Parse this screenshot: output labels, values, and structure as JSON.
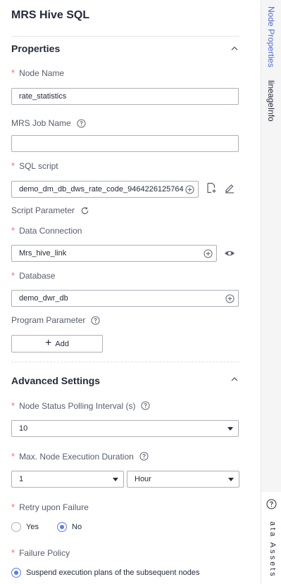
{
  "panel": {
    "title": "MRS Hive SQL"
  },
  "properties": {
    "section_title": "Properties",
    "node_name": {
      "label": "Node Name",
      "value": "rate_statistics"
    },
    "mrs_job_name": {
      "label": "MRS Job Name",
      "value": ""
    },
    "sql_script": {
      "label": "SQL script",
      "value": "demo_dm_db_dws_rate_code_9464226125764"
    },
    "script_parameter": {
      "label": "Script Parameter"
    },
    "data_connection": {
      "label": "Data Connection",
      "value": "Mrs_hive_link"
    },
    "database": {
      "label": "Database",
      "value": "demo_dwr_db"
    },
    "program_parameter": {
      "label": "Program Parameter",
      "add_label": "Add"
    }
  },
  "advanced": {
    "section_title": "Advanced Settings",
    "polling_interval": {
      "label": "Node Status Polling Interval (s)",
      "value": "10"
    },
    "max_duration": {
      "label": "Max. Node Execution Duration",
      "value": "1",
      "unit": "Hour"
    },
    "retry": {
      "label": "Retry upon Failure",
      "options": [
        "Yes",
        "No"
      ],
      "selected": "No"
    },
    "failure_policy": {
      "label": "Failure Policy",
      "selected_option": "Suspend execution plans of the subsequent nodes"
    }
  },
  "rail": {
    "tab_node_properties": "Node Properties",
    "tab_lineage": "lineageInfo",
    "assistant_text": "ata Assets"
  },
  "colors": {
    "accent": "#5e7ce0",
    "required": "#f66f6a",
    "active_tab": "#526ecc"
  }
}
